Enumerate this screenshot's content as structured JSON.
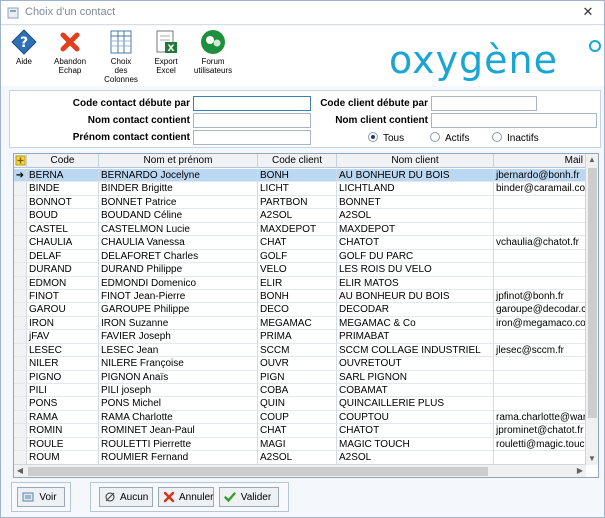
{
  "window": {
    "title": "Choix d'un contact",
    "close_glyph": "✕"
  },
  "toolbar": {
    "aide": "Aide",
    "abandon": [
      "Abandon",
      "Echap"
    ],
    "choix": [
      "Choix",
      "des",
      "Colonnes"
    ],
    "export": [
      "Export",
      "Excel"
    ],
    "forum": [
      "Forum",
      "utilisateurs"
    ]
  },
  "logo": {
    "text": "oxygène"
  },
  "search": {
    "code_contact_label": "Code contact débute par",
    "code_contact_value": "",
    "nom_contact_label": "Nom contact contient",
    "nom_contact_value": "",
    "prenom_contact_label": "Prénom contact contient",
    "prenom_contact_value": "",
    "code_client_label": "Code client débute par",
    "code_client_value": "",
    "nom_client_label": "Nom client contient",
    "nom_client_value": "",
    "radio_tous": "Tous",
    "radio_actifs": "Actifs",
    "radio_inactifs": "Inactifs",
    "radio_selected": "tous"
  },
  "grid": {
    "columns": [
      "Code",
      "Nom et prénom",
      "Code client",
      "Nom client",
      "Mail"
    ],
    "rows": [
      [
        "BERNA",
        "BERNARDO Jocelyne",
        "BONH",
        "AU BONHEUR DU BOIS",
        "jbernardo@bonh.fr"
      ],
      [
        "BINDE",
        "BINDER Brigitte",
        "LICHT",
        "LICHTLAND",
        "binder@caramail.co"
      ],
      [
        "BONNOT",
        "BONNET Patrice",
        "PARTBON",
        "BONNET",
        ""
      ],
      [
        "BOUD",
        "BOUDAND Céline",
        "A2SOL",
        "A2SOL",
        ""
      ],
      [
        "CASTEL",
        "CASTELMON Lucie",
        "MAXDEPOT",
        "MAXDEPOT",
        ""
      ],
      [
        "CHAULIA",
        "CHAULIA Vanessa",
        "CHAT",
        "CHATOT",
        "vchaulia@chatot.fr"
      ],
      [
        "DELAF",
        "DELAFORET Charles",
        "GOLF",
        "GOLF DU PARC",
        ""
      ],
      [
        "DURAND",
        "DURAND Philippe",
        "VELO",
        "LES ROIS DU VELO",
        ""
      ],
      [
        "EDMON",
        "EDMONDI Domenico",
        "ELIR",
        "ELIR MATOS",
        ""
      ],
      [
        "FINOT",
        "FINOT Jean-Pierre",
        "BONH",
        "AU BONHEUR DU BOIS",
        "jpfinot@bonh.fr"
      ],
      [
        "GAROU",
        "GAROUPE Philippe",
        "DECO",
        "DECODAR",
        "garoupe@decodar.c"
      ],
      [
        "IRON",
        "IRON Suzanne",
        "MEGAMAC",
        "MEGAMAC & Co",
        "iron@megamaco.co"
      ],
      [
        "jFAV",
        "FAVIER Joseph",
        "PRIMA",
        "PRIMABAT",
        ""
      ],
      [
        "LESEC",
        "LESEC Jean",
        "SCCM",
        "SCCM COLLAGE INDUSTRIEL",
        "jlesec@sccm.fr"
      ],
      [
        "NILER",
        "NILERE Françoise",
        "OUVR",
        "OUVRETOUT",
        ""
      ],
      [
        "PIGNO",
        "PIGNON Anaïs",
        "PIGN",
        "SARL PIGNON",
        ""
      ],
      [
        "PILI",
        "PILI joseph",
        "COBA",
        "COBAMAT",
        ""
      ],
      [
        "PONS",
        "PONS Michel",
        "QUIN",
        "QUINCAILLERIE PLUS",
        ""
      ],
      [
        "RAMA",
        "RAMA Charlotte",
        "COUP",
        "COUPTOU",
        "rama.charlotte@war"
      ],
      [
        "ROMIN",
        "ROMINET Jean-Paul",
        "CHAT",
        "CHATOT",
        "jprominet@chatot.fr"
      ],
      [
        "ROULE",
        "ROULETTI Pierrette",
        "MAGI",
        "MAGIC TOUCH",
        "rouletti@magic.touc"
      ],
      [
        "ROUM",
        "ROUMIER Fernand",
        "A2SOL",
        "A2SOL",
        ""
      ]
    ],
    "selected_row": 0,
    "current_row_glyph": "➜"
  },
  "buttons": {
    "voir": "Voir",
    "aucun": "Aucun",
    "annuler": "Annuler",
    "valider": "Valider"
  },
  "colors": {
    "accent": "#1aa5d4",
    "selection": "#bcd7f2"
  }
}
